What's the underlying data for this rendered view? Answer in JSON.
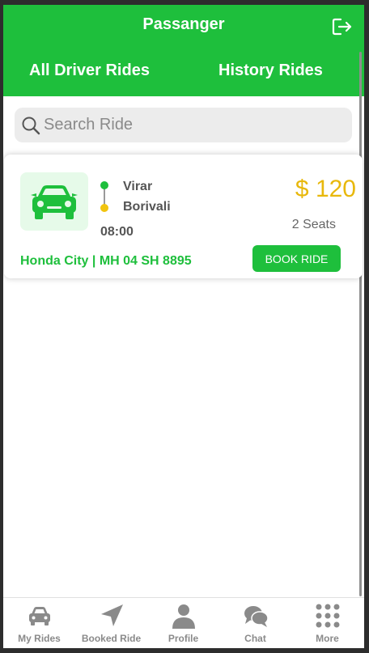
{
  "header": {
    "title": "Passanger",
    "logout_icon": "logout-icon"
  },
  "tabs": [
    {
      "label": "All Driver Rides"
    },
    {
      "label": "History Rides"
    }
  ],
  "search": {
    "placeholder": "Search Ride",
    "value": ""
  },
  "rides": [
    {
      "from": "Virar",
      "to": "Borivali",
      "time": "08:00",
      "price": "$ 120",
      "seats": "2 Seats",
      "vehicle": "Honda City | MH 04 SH 8895",
      "book_label": "BOOK RIDE",
      "icon": "car-icon"
    }
  ],
  "bottom_nav": [
    {
      "label": "My Rides",
      "icon": "car-icon"
    },
    {
      "label": "Booked Ride",
      "icon": "navigation-arrow-icon"
    },
    {
      "label": "Profile",
      "icon": "person-icon"
    },
    {
      "label": "Chat",
      "icon": "chat-icon"
    },
    {
      "label": "More",
      "icon": "grid-dots-icon"
    }
  ],
  "colors": {
    "primary": "#1ebf3c",
    "price": "#e8b80c",
    "nav_gray": "#8a8a8a"
  }
}
